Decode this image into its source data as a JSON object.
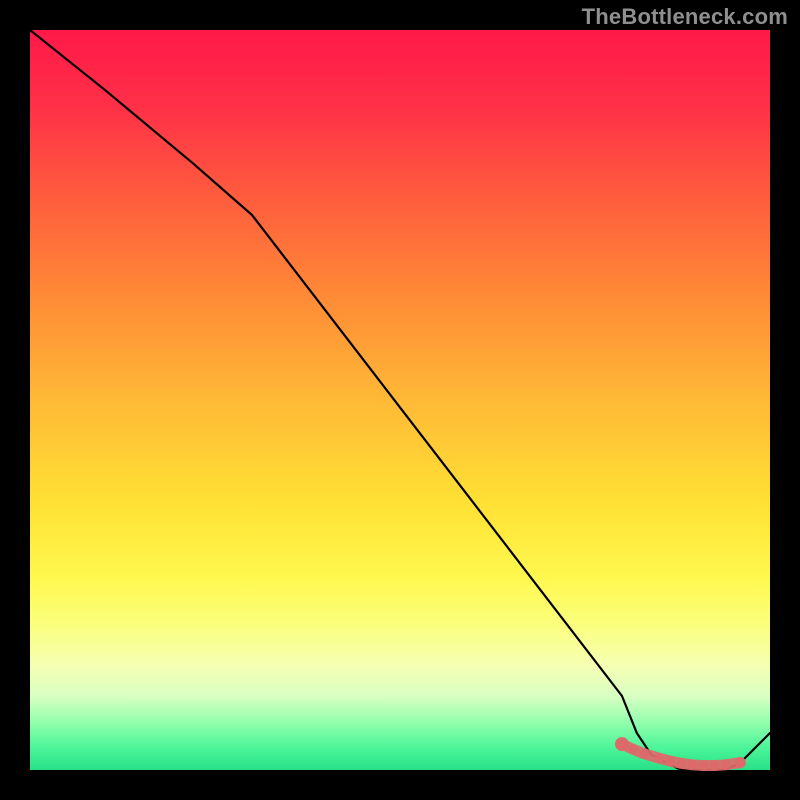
{
  "watermark": "TheBottleneck.com",
  "chart_data": {
    "type": "line",
    "title": "",
    "xlabel": "",
    "ylabel": "",
    "xlim": [
      0,
      100
    ],
    "ylim": [
      0,
      100
    ],
    "series": [
      {
        "name": "bottleneck-curve",
        "x": [
          0,
          10,
          22,
          30,
          40,
          50,
          60,
          70,
          80,
          82,
          84,
          86,
          88,
          90,
          92,
          94,
          96,
          100
        ],
        "y": [
          100,
          92,
          82,
          75,
          62,
          49,
          36,
          23,
          10,
          5,
          2,
          1,
          0,
          0,
          0,
          0,
          1,
          5
        ]
      }
    ],
    "markers": {
      "name": "highlight-points",
      "x": [
        80,
        81.5,
        83,
        85,
        86.5,
        88,
        89.5,
        91,
        92.5,
        94,
        96
      ],
      "y": [
        3.5,
        2.8,
        2.2,
        1.6,
        1.2,
        0.9,
        0.7,
        0.6,
        0.6,
        0.7,
        1.0
      ]
    },
    "gradient_stops": [
      {
        "pos": 0,
        "color": "#ff1948"
      },
      {
        "pos": 10,
        "color": "#ff2f48"
      },
      {
        "pos": 22,
        "color": "#ff5a3e"
      },
      {
        "pos": 36,
        "color": "#ff8a36"
      },
      {
        "pos": 50,
        "color": "#ffb936"
      },
      {
        "pos": 64,
        "color": "#ffe134"
      },
      {
        "pos": 74,
        "color": "#fff84e"
      },
      {
        "pos": 80,
        "color": "#fbff7a"
      },
      {
        "pos": 86,
        "color": "#f5ffb4"
      },
      {
        "pos": 90,
        "color": "#d8ffc1"
      },
      {
        "pos": 93,
        "color": "#9dffb0"
      },
      {
        "pos": 97,
        "color": "#4cf598"
      },
      {
        "pos": 100,
        "color": "#28e089"
      }
    ]
  }
}
